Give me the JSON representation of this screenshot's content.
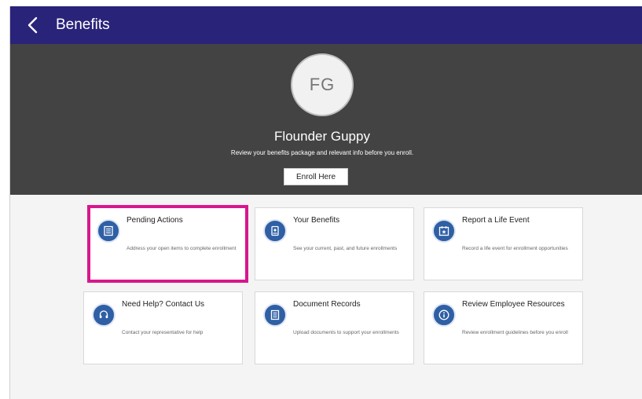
{
  "header": {
    "title": "Benefits"
  },
  "profile": {
    "initials": "FG",
    "name": "Flounder Guppy",
    "tagline": "Review your benefits package and relevant info before you enroll.",
    "enroll_label": "Enroll Here"
  },
  "cards": [
    {
      "title": "Pending Actions",
      "desc": "Address your open items to complete enrollment",
      "icon": "list-icon"
    },
    {
      "title": "Your Benefits",
      "desc": "See your current, past, and future enrollments",
      "icon": "badge-icon"
    },
    {
      "title": "Report a Life Event",
      "desc": "Record a life event for enrollment opportunities",
      "icon": "calendar-star-icon"
    },
    {
      "title": "Need Help? Contact Us",
      "desc": "Contact your representative for help",
      "icon": "headset-icon"
    },
    {
      "title": "Document Records",
      "desc": "Upload documents to support your enrollments",
      "icon": "document-icon"
    },
    {
      "title": "Review Employee Resources",
      "desc": "Review enrollment guidelines before you enroll",
      "icon": "info-icon"
    }
  ],
  "colors": {
    "header_bg": "#2a237a",
    "hero_bg": "#434343",
    "icon_blue": "#2f5fa5",
    "highlight": "#d9168d"
  }
}
